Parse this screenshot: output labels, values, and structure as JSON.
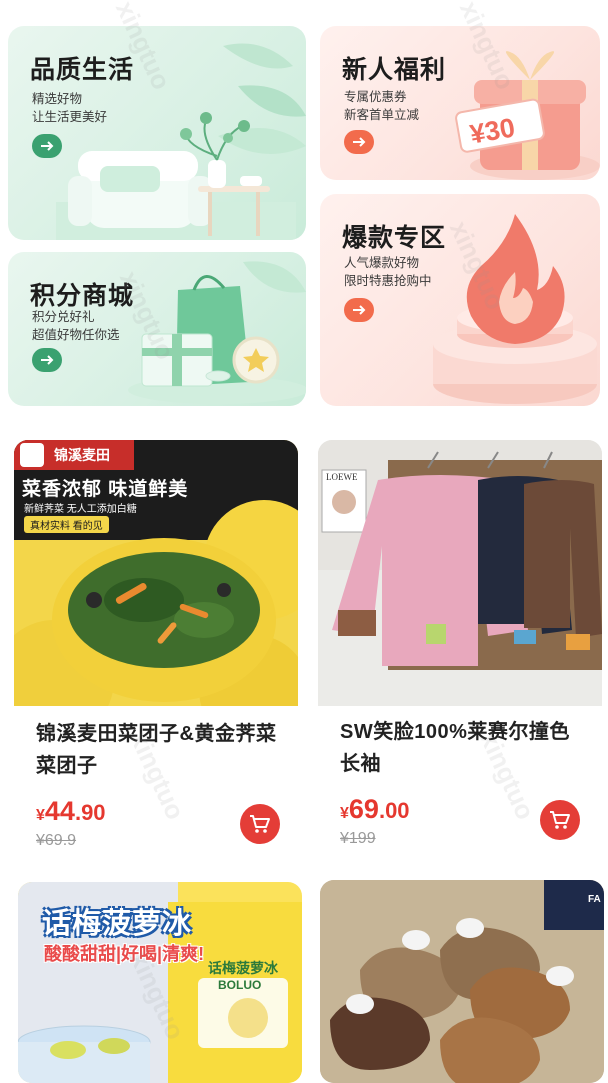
{
  "promos": [
    {
      "title": "品质生活",
      "sub1": "精选好物",
      "sub2": "让生活更美好"
    },
    {
      "title": "新人福利",
      "sub1": "专属优惠券",
      "sub2": "新客首单立减",
      "coupon": "¥30"
    },
    {
      "title": "积分商城",
      "sub1": "积分兑好礼",
      "sub2": "超值好物任你选"
    },
    {
      "title": "爆款专区",
      "sub1": "人气爆款好物",
      "sub2": "限时特惠抢购中"
    }
  ],
  "products": [
    {
      "name": "锦溪麦田菜团子&黄金荠菜菜团子",
      "currency": "¥",
      "price_int": "44",
      "price_dec": ".90",
      "orig": "¥69.9",
      "banner": {
        "brand": "锦溪麦田",
        "headline": "菜香浓郁 味道鲜美",
        "small": "新鲜荠菜 无人工添加白糖",
        "tag": "真材实料 看的见"
      }
    },
    {
      "name": "SW笑脸100%莱赛尔撞色长袖",
      "currency": "¥",
      "price_int": "69",
      "price_dec": ".00",
      "orig": "¥199",
      "banner": {
        "poster": "LOEWE"
      }
    },
    {
      "name": "",
      "banner": {
        "title": "话梅菠萝冰",
        "sub": "酸酸甜甜|好喝|清爽!",
        "pack": "话梅菠萝冰",
        "packsub": "BOLUO"
      }
    },
    {
      "name": "",
      "banner": {
        "corner": "FA"
      }
    }
  ],
  "colors": {
    "accent": "#e43d37",
    "green": "#3aa170",
    "orange": "#f26b4c"
  },
  "watermark": "xingtuo"
}
